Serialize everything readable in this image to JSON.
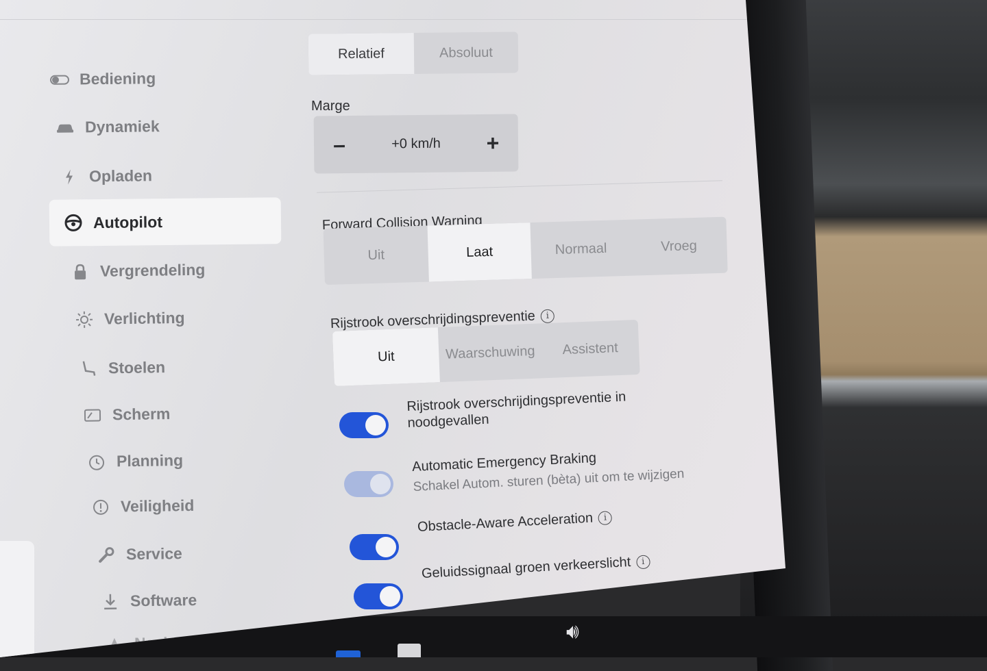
{
  "sidebar": {
    "items": [
      {
        "label": "Bediening",
        "icon": "toggle-icon"
      },
      {
        "label": "Dynamiek",
        "icon": "car-icon"
      },
      {
        "label": "Opladen",
        "icon": "bolt-icon"
      },
      {
        "label": "Autopilot",
        "icon": "steering-wheel-icon",
        "active": true
      },
      {
        "label": "Vergrendeling",
        "icon": "lock-icon"
      },
      {
        "label": "Verlichting",
        "icon": "sun-icon"
      },
      {
        "label": "Stoelen",
        "icon": "seat-icon"
      },
      {
        "label": "Scherm",
        "icon": "display-icon"
      },
      {
        "label": "Planning",
        "icon": "clock-icon"
      },
      {
        "label": "Veiligheid",
        "icon": "alert-circle-icon"
      },
      {
        "label": "Service",
        "icon": "wrench-icon"
      },
      {
        "label": "Software",
        "icon": "download-icon"
      },
      {
        "label": "Navigatie",
        "icon": "navigation-icon"
      }
    ]
  },
  "speed_mode": {
    "options": [
      "Relatief",
      "Absoluut"
    ],
    "selected": "Relatief"
  },
  "margin": {
    "label": "Marge",
    "value": "+0 km/h",
    "minus": "–",
    "plus": "+"
  },
  "fcw": {
    "label": "Forward Collision Warning",
    "options": [
      "Uit",
      "Laat",
      "Normaal",
      "Vroeg"
    ],
    "selected": "Laat"
  },
  "lane": {
    "label": "Rijstrook overschrijdingspreventie",
    "info": "i",
    "options": [
      "Uit",
      "Waarschuwing",
      "Assistent"
    ],
    "selected": "Uit"
  },
  "toggles": [
    {
      "label": "Rijstrook overschrijdingspreventie in",
      "label2": "noodgevallen",
      "on": true,
      "disabled": false
    },
    {
      "label": "Automatic Emergency Braking",
      "sub": "Schakel Autom. sturen (bèta) uit om te wijzigen",
      "on": true,
      "disabled": true
    },
    {
      "label": "Obstacle-Aware Acceleration",
      "info": "i",
      "on": true,
      "disabled": false
    },
    {
      "label": "Geluidssignaal groen verkeerslicht",
      "info": "i",
      "on": true,
      "disabled": false
    }
  ],
  "colors": {
    "accent": "#2355d8",
    "screen": "#e4e4e7"
  }
}
